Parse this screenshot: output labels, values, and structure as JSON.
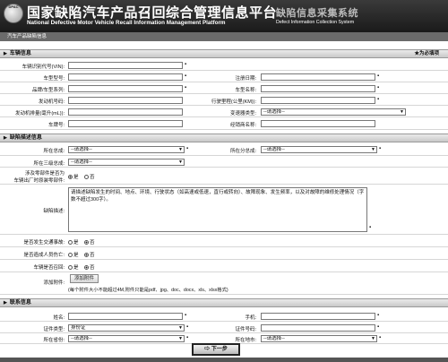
{
  "header": {
    "logo_text": "DPAC",
    "title_cn": "国家缺陷汽车产品召回综合管理信息平台",
    "title_en": "National Defective Motor Vehicle Recall Information Management Platform",
    "subsystem_cn": "缺陷信息采集系统",
    "subsystem_en": "Defect Information Collection System"
  },
  "breadcrumb": "汽车产品缺陷信息",
  "vehicle_section": {
    "title": "车辆信息",
    "required_note": "★为必填项",
    "vin_label": "车辆识别代号(VIN):",
    "model_label": "车型型号:",
    "brand_series_label": "品牌/车型系列:",
    "engine_no_label": "发动机号码:",
    "displacement_label": "发动机排量(毫升(mL)):",
    "plate_label": "车牌号:",
    "reg_date_label": "注册日期:",
    "model_name_label": "车型名称:",
    "mileage_label": "行驶里程(公里(KM)):",
    "transmission_label": "变速器类型:",
    "transmission_value": "--请选择--",
    "dealer_label": "经销商名称:"
  },
  "defect_section": {
    "title": "缺陷描述信息",
    "assembly_label": "所在总成:",
    "assembly_value": "--请选择--",
    "subassembly_label": "所在分总成:",
    "subassembly_value": "--请选择--",
    "tertiary_label": "所在三级总成:",
    "tertiary_value": "--请选择--",
    "fault_question_line1": "涉及零部件是否为",
    "fault_question_line2": "车辆出厂时原装零部件:",
    "yes": "是",
    "no": "否",
    "description_label": "缺陷描述:",
    "description_text": "请描述缺陷发生的时间、地点、环境、行驶状态（如高速或低速，直行或转向）、故障现象、发生频率，以及对故障的维修处理情况（字数不超过300字）。",
    "accident_label": "是否发生交通事故:",
    "injury_label": "是否造成人员伤亡:",
    "recall_label": "车辆是否召回:",
    "attachment_label": "添加附件:",
    "attachment_button": "添加附件",
    "attachment_note": "(每个附件大小不能超过4M,附件只能是pdf、jpg、doc、docx、xls、xlsx格式)"
  },
  "contact_section": {
    "title": "联系信息",
    "name_label": "姓名:",
    "id_type_label": "证件类型:",
    "id_type_value": "身份证",
    "province_label": "所在省份:",
    "province_value": "--请选择--",
    "mobile_label": "手机:",
    "id_no_label": "证件号码:",
    "city_label": "所在地市:",
    "city_value": "--请选择--"
  },
  "next_button": "下一步",
  "icons": {
    "dropdown": "dropdown-arrow-icon",
    "required": "required-star-icon",
    "next": "arrow-right-icon"
  }
}
